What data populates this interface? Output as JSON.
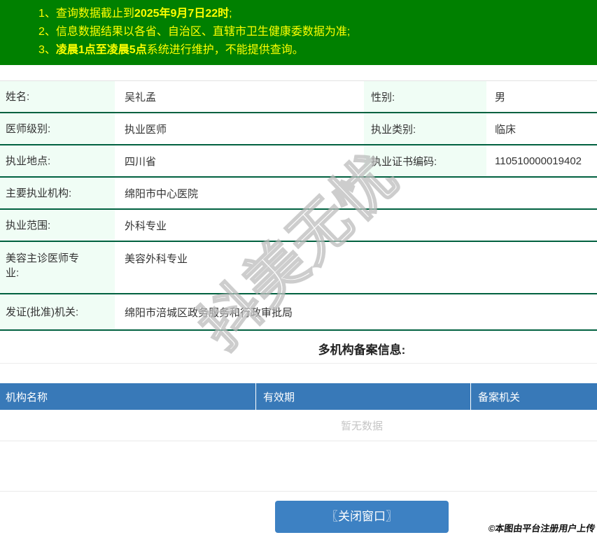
{
  "notice": {
    "lines": [
      {
        "num": "1、",
        "pre": "查询数据截止到",
        "bold": "2025年9月7日22时",
        "post": ";"
      },
      {
        "num": "2、",
        "pre": "信息数据结果以各省、自治区、直辖市卫生健康委数据为准;",
        "bold": "",
        "post": ""
      },
      {
        "num": "3、",
        "pre": "",
        "bold": "凌晨1点至凌晨5点",
        "post": "系统进行维护，不能提供查询。"
      }
    ]
  },
  "info_table": {
    "rows": [
      {
        "label1": "姓名:",
        "value1": "吴礼孟",
        "label2": "性别:",
        "value2": "男"
      },
      {
        "label1": "医师级别:",
        "value1": "执业医师",
        "label2": "执业类别:",
        "value2": "临床"
      },
      {
        "label1": "执业地点:",
        "value1": "四川省",
        "label2": "执业证书编码:",
        "value2": "110510000019402"
      },
      {
        "label1": "主要执业机构:",
        "value1": "绵阳市中心医院"
      },
      {
        "label1": "执业范围:",
        "value1": "外科专业"
      },
      {
        "label1": "美容主诊医师专业:",
        "value1": "美容外科专业"
      },
      {
        "label1": "发证(批准)机关:",
        "value1": "绵阳市涪城区政务服务和行政审批局"
      }
    ]
  },
  "filing_section": {
    "title": "多机构备案信息:",
    "columns": [
      "机构名称",
      "有效期",
      "备案机关"
    ],
    "empty_text": "暂无数据"
  },
  "footer": {
    "close_button_label": "〖关闭窗口〗"
  },
  "overlays": {
    "watermark": "抖美无忧",
    "copyright": "©本图由平台注册用户上传"
  },
  "colors": {
    "banner_green": "#008000",
    "notice_yellow": "#ffff00",
    "label_cell_bg": "#f0fdf5",
    "row_divider_green": "#016140",
    "table_header_blue": "#3879b8",
    "close_button_blue": "#3d81c3",
    "empty_text_gray": "#c6c6c6"
  }
}
